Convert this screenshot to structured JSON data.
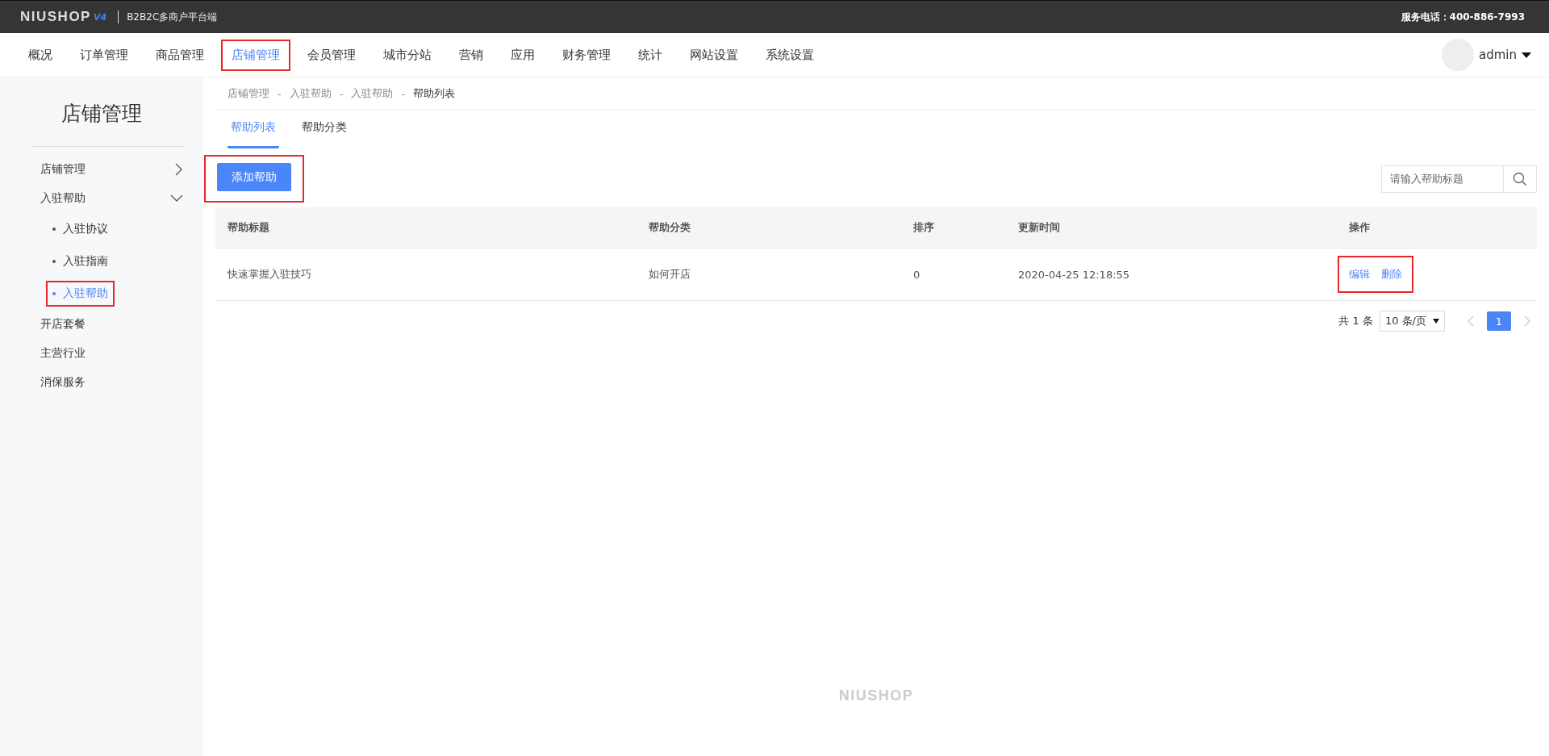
{
  "top_bar": {
    "logo": "NIUSHOP",
    "logo_version": "V4",
    "subtitle": "B2B2C多商户平台端",
    "service_phone": "服务电话：400-886-7993"
  },
  "nav": [
    {
      "label": "概况",
      "selected": false,
      "highlighted": false
    },
    {
      "label": "订单管理",
      "selected": false,
      "highlighted": false
    },
    {
      "label": "商品管理",
      "selected": false,
      "highlighted": false
    },
    {
      "label": "店铺管理",
      "selected": true,
      "highlighted": true
    },
    {
      "label": "会员管理",
      "selected": false,
      "highlighted": false
    },
    {
      "label": "城市分站",
      "selected": false,
      "highlighted": false
    },
    {
      "label": "营销",
      "selected": false,
      "highlighted": false
    },
    {
      "label": "应用",
      "selected": false,
      "highlighted": false
    },
    {
      "label": "财务管理",
      "selected": false,
      "highlighted": false
    },
    {
      "label": "统计",
      "selected": false,
      "highlighted": false
    },
    {
      "label": "网站设置",
      "selected": false,
      "highlighted": false
    },
    {
      "label": "系统设置",
      "selected": false,
      "highlighted": false
    }
  ],
  "user": {
    "name": "admin"
  },
  "sidebar": {
    "title": "店铺管理",
    "items": [
      {
        "label": "店铺管理",
        "expanded": false
      },
      {
        "label": "入驻帮助",
        "expanded": true,
        "children": [
          {
            "label": "入驻协议",
            "selected": false,
            "highlighted": false
          },
          {
            "label": "入驻指南",
            "selected": false,
            "highlighted": false
          },
          {
            "label": "入驻帮助",
            "selected": true,
            "highlighted": true
          }
        ]
      },
      {
        "label": "开店套餐"
      },
      {
        "label": "主营行业"
      },
      {
        "label": "消保服务"
      }
    ]
  },
  "breadcrumb": {
    "separator": "-",
    "items": [
      "店铺管理",
      "入驻帮助",
      "入驻帮助",
      "帮助列表"
    ]
  },
  "tabs": [
    {
      "label": "帮助列表",
      "selected": true
    },
    {
      "label": "帮助分类",
      "selected": false
    }
  ],
  "add_button": {
    "label": "添加帮助",
    "highlighted": true
  },
  "search": {
    "placeholder": "请输入帮助标题"
  },
  "table": {
    "columns": [
      "帮助标题",
      "帮助分类",
      "排序",
      "更新时间",
      "操作"
    ],
    "rows": [
      {
        "title": "快速掌握入驻技巧",
        "category": "如何开店",
        "sort": "0",
        "updated": "2020-04-25 12:18:55",
        "actions": [
          "编辑",
          "删除"
        ],
        "actions_highlighted": true
      }
    ]
  },
  "pagination": {
    "total": "共 1 条",
    "page_size": "10 条/页",
    "pages": [
      {
        "label": "1",
        "selected": true
      }
    ]
  },
  "footer": {
    "logo": "NIUSHOP"
  }
}
